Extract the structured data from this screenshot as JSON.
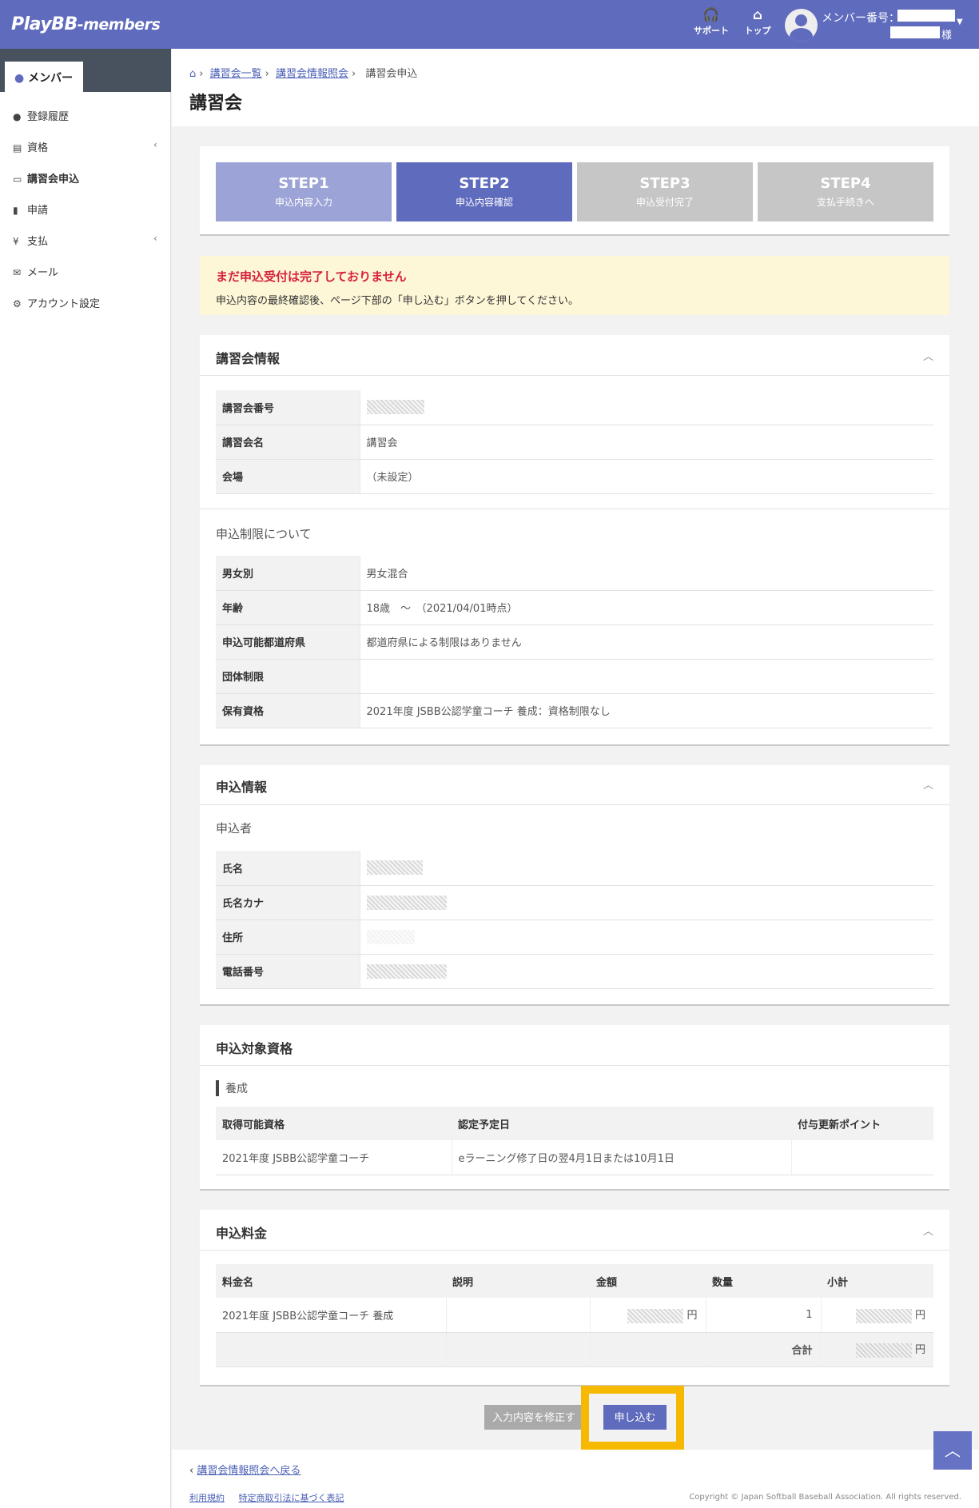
{
  "header": {
    "logo": "PlayBB",
    "logo_suffix": "-members",
    "support_label": "サポート",
    "top_label": "トップ",
    "member_no_label": "メンバー番号：",
    "sama": "様"
  },
  "sidebar": {
    "active": "メンバー",
    "items": [
      {
        "label": "登録履歴",
        "icon": "user-icon"
      },
      {
        "label": "資格",
        "icon": "id-card-icon"
      },
      {
        "label": "講習会申込",
        "icon": "desktop-user-icon"
      },
      {
        "label": "申請",
        "icon": "document-icon"
      },
      {
        "label": "支払",
        "icon": "yen-icon"
      },
      {
        "label": "メール",
        "icon": "envelope-icon"
      },
      {
        "label": "アカウント設定",
        "icon": "user-gear-icon"
      }
    ]
  },
  "breadcrumb": {
    "items": [
      "講習会一覧",
      "講習会情報照会",
      "講習会申込"
    ]
  },
  "page": {
    "title": "講習会"
  },
  "steps": [
    {
      "title": "STEP1",
      "sub": "申込内容入力",
      "state": "done"
    },
    {
      "title": "STEP2",
      "sub": "申込内容確認",
      "state": "active"
    },
    {
      "title": "STEP3",
      "sub": "申込受付完了",
      "state": "pending"
    },
    {
      "title": "STEP4",
      "sub": "支払手続きへ",
      "state": "pending"
    }
  ],
  "alert": {
    "title": "まだ申込受付は完了しておりません",
    "body": "申込内容の最終確認後、ページ下部の「申し込む」ボタンを押してください。"
  },
  "course": {
    "title": "講習会情報",
    "rows": [
      {
        "k": "講習会番号",
        "v": ""
      },
      {
        "k": "講習会名",
        "v": "講習会"
      },
      {
        "k": "会場",
        "v": "（未設定）"
      }
    ],
    "limits_title": "申込制限について",
    "limits": [
      {
        "k": "男女別",
        "v": "男女混合"
      },
      {
        "k": "年齢",
        "v": "18歳　～　（2021/04/01時点）"
      },
      {
        "k": "申込可能都道府県",
        "v": "都道府県による制限はありません"
      },
      {
        "k": "団体制限",
        "v": ""
      },
      {
        "k": "保有資格",
        "v": "2021年度 JSBB公認学童コーチ 養成：資格制限なし"
      }
    ]
  },
  "applicant": {
    "title": "申込情報",
    "sub": "申込者",
    "rows": [
      {
        "k": "氏名",
        "v": ""
      },
      {
        "k": "氏名カナ",
        "v": ""
      },
      {
        "k": "住所",
        "v": ""
      },
      {
        "k": "電話番号",
        "v": ""
      }
    ]
  },
  "qualification": {
    "title": "申込対象資格",
    "sub": "養成",
    "headers": [
      "取得可能資格",
      "認定予定日",
      "付与更新ポイント"
    ],
    "rows": [
      [
        "2021年度 JSBB公認学童コーチ",
        "eラーニング修了日の翌4月1日または10月1日",
        ""
      ]
    ]
  },
  "fee": {
    "title": "申込料金",
    "headers": [
      "料金名",
      "説明",
      "金額",
      "数量",
      "小計"
    ],
    "rows": [
      {
        "name": "2021年度 JSBB公認学童コーチ 養成",
        "desc": "",
        "amount_unit": "円",
        "qty": "1",
        "subtotal_unit": "円"
      }
    ],
    "total_label": "合計",
    "total_unit": "円"
  },
  "buttons": {
    "edit": "入力内容を修正す",
    "apply": "申し込む"
  },
  "footer": {
    "back": "講習会情報照会へ戻る",
    "links": [
      "利用規約",
      "特定商取引法に基づく表記"
    ],
    "copyright": "Copyright © Japan Softball Baseball Association. All rights reserved."
  },
  "colors": {
    "brand": "#5f6bbd",
    "step_done": "#9ca3d6",
    "step_pending": "#c6c6c6",
    "alert_text": "#d6203c",
    "highlight": "#f6b800"
  }
}
